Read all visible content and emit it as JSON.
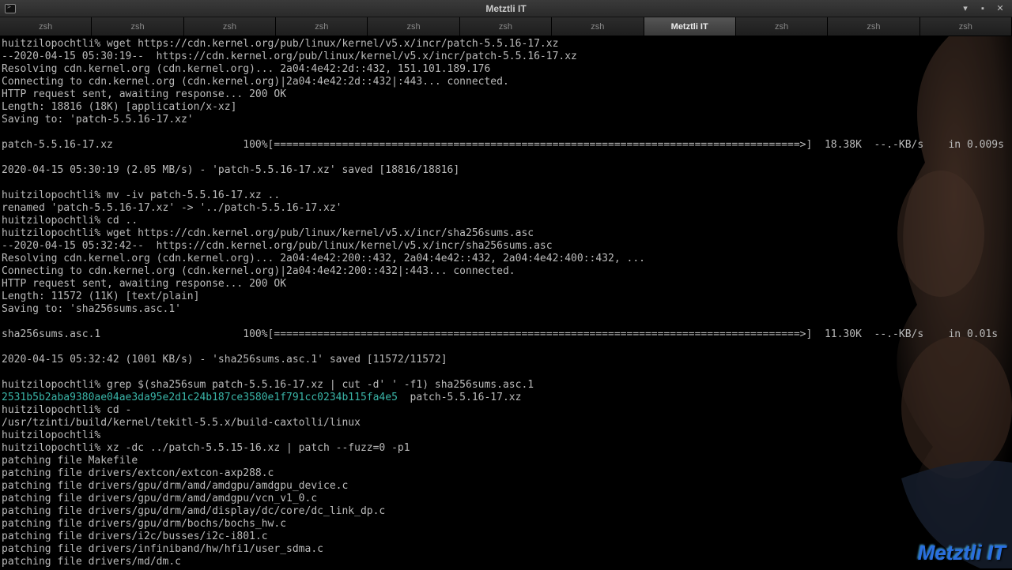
{
  "window": {
    "title": "Metztli IT",
    "buttons": {
      "min": "▾",
      "max": "▪",
      "close": "✕"
    }
  },
  "tabs": [
    {
      "label": "zsh",
      "active": false
    },
    {
      "label": "zsh",
      "active": false
    },
    {
      "label": "zsh",
      "active": false
    },
    {
      "label": "zsh",
      "active": false
    },
    {
      "label": "zsh",
      "active": false
    },
    {
      "label": "zsh",
      "active": false
    },
    {
      "label": "zsh",
      "active": false
    },
    {
      "label": "Metztli IT",
      "active": true
    },
    {
      "label": "zsh",
      "active": false
    },
    {
      "label": "zsh",
      "active": false
    },
    {
      "label": "zsh",
      "active": false
    }
  ],
  "terminal": {
    "lines": [
      "huitzilopochtli% wget https://cdn.kernel.org/pub/linux/kernel/v5.x/incr/patch-5.5.16-17.xz",
      "--2020-04-15 05:30:19--  https://cdn.kernel.org/pub/linux/kernel/v5.x/incr/patch-5.5.16-17.xz",
      "Resolving cdn.kernel.org (cdn.kernel.org)... 2a04:4e42:2d::432, 151.101.189.176",
      "Connecting to cdn.kernel.org (cdn.kernel.org)|2a04:4e42:2d::432|:443... connected.",
      "HTTP request sent, awaiting response... 200 OK",
      "Length: 18816 (18K) [application/x-xz]",
      "Saving to: 'patch-5.5.16-17.xz'",
      "",
      "patch-5.5.16-17.xz                     100%[=====================================================================================>]  18.38K  --.-KB/s    in 0.009s",
      "",
      "2020-04-15 05:30:19 (2.05 MB/s) - 'patch-5.5.16-17.xz' saved [18816/18816]",
      "",
      "huitzilopochtli% mv -iv patch-5.5.16-17.xz ..",
      "renamed 'patch-5.5.16-17.xz' -> '../patch-5.5.16-17.xz'",
      "huitzilopochtli% cd ..",
      "huitzilopochtli% wget https://cdn.kernel.org/pub/linux/kernel/v5.x/incr/sha256sums.asc",
      "--2020-04-15 05:32:42--  https://cdn.kernel.org/pub/linux/kernel/v5.x/incr/sha256sums.asc",
      "Resolving cdn.kernel.org (cdn.kernel.org)... 2a04:4e42:200::432, 2a04:4e42::432, 2a04:4e42:400::432, ...",
      "Connecting to cdn.kernel.org (cdn.kernel.org)|2a04:4e42:200::432|:443... connected.",
      "HTTP request sent, awaiting response... 200 OK",
      "Length: 11572 (11K) [text/plain]",
      "Saving to: 'sha256sums.asc.1'",
      "",
      "sha256sums.asc.1                       100%[=====================================================================================>]  11.30K  --.-KB/s    in 0.01s",
      "",
      "2020-04-15 05:32:42 (1001 KB/s) - 'sha256sums.asc.1' saved [11572/11572]",
      "",
      "huitzilopochtli% grep $(sha256sum patch-5.5.16-17.xz | cut -d' ' -f1) sha256sums.asc.1",
      {
        "text": "2531b5b2aba9380ae04ae3da95e2d1c24b187ce3580e1f791cc0234b115fa4e5  patch-5.5.16-17.xz",
        "hl_len": 64
      },
      "huitzilopochtli% cd -",
      "/usr/tzinti/build/kernel/tekitl-5.5.x/build-caxtolli/linux",
      "huitzilopochtli%",
      "huitzilopochtli% xz -dc ../patch-5.5.15-16.xz | patch --fuzz=0 -p1",
      "patching file Makefile",
      "patching file drivers/extcon/extcon-axp288.c",
      "patching file drivers/gpu/drm/amd/amdgpu/amdgpu_device.c",
      "patching file drivers/gpu/drm/amd/amdgpu/vcn_v1_0.c",
      "patching file drivers/gpu/drm/amd/display/dc/core/dc_link_dp.c",
      "patching file drivers/gpu/drm/bochs/bochs_hw.c",
      "patching file drivers/i2c/busses/i2c-i801.c",
      "patching file drivers/infiniband/hw/hfi1/user_sdma.c",
      "patching file drivers/md/dm.c"
    ]
  },
  "watermark": "Metztli IT"
}
